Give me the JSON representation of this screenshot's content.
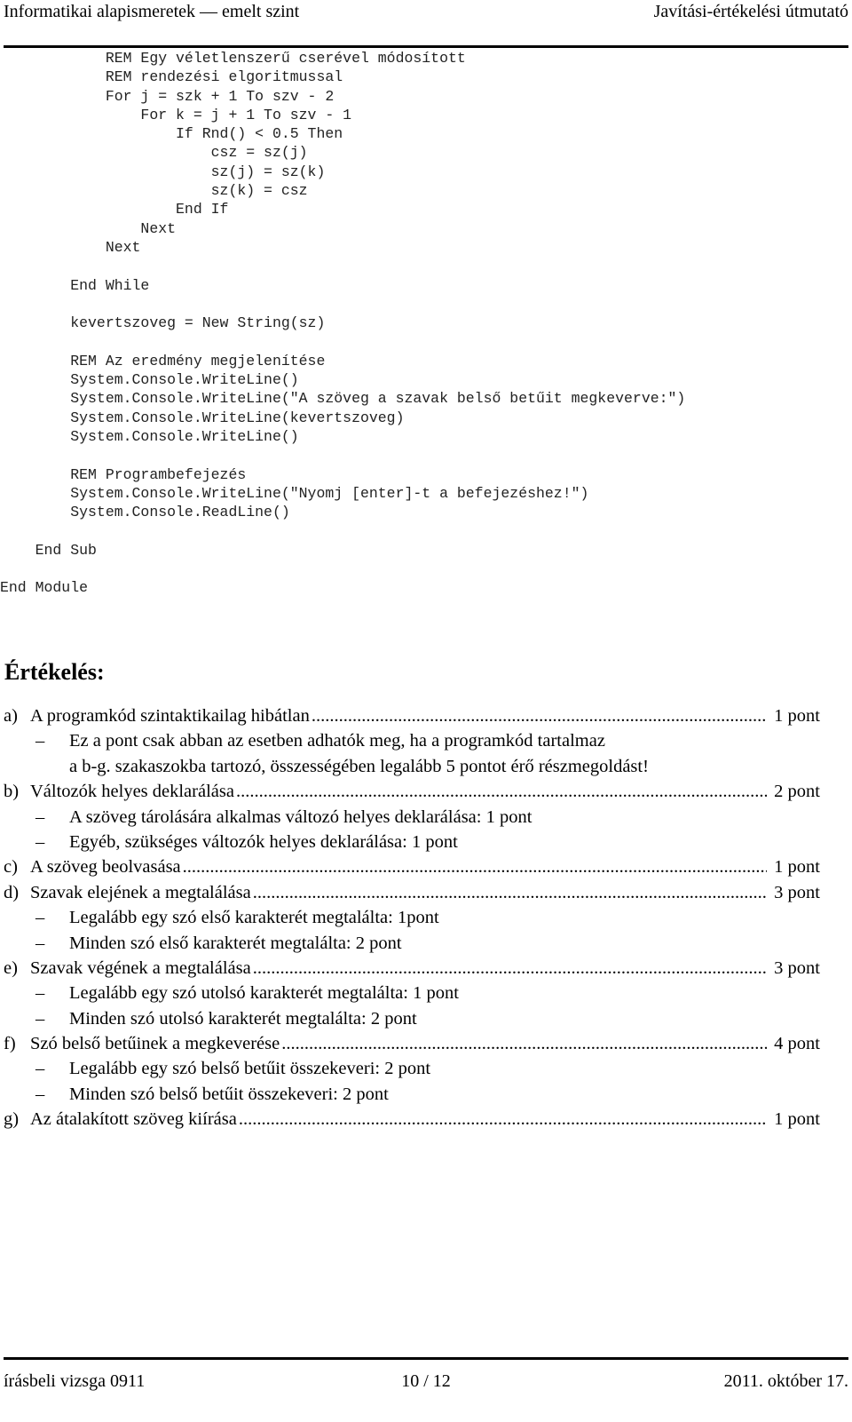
{
  "header": {
    "left": "Informatikai alapismeretek — emelt szint",
    "right": "Javítási-értékelési útmutató"
  },
  "code": {
    "lines": [
      "            REM Egy véletlenszerű cserével módosított",
      "            REM rendezési elgoritmussal",
      "            For j = szk + 1 To szv - 2",
      "                For k = j + 1 To szv - 1",
      "                    If Rnd() < 0.5 Then",
      "                        csz = sz(j)",
      "                        sz(j) = sz(k)",
      "                        sz(k) = csz",
      "                    End If",
      "                Next",
      "            Next",
      "",
      "        End While",
      "",
      "        kevertszoveg = New String(sz)",
      "",
      "        REM Az eredmény megjelenítése",
      "        System.Console.WriteLine()",
      "        System.Console.WriteLine(\"A szöveg a szavak belső betűit megkeverve:\")",
      "        System.Console.WriteLine(kevertszoveg)",
      "        System.Console.WriteLine()",
      "",
      "        REM Programbefejezés",
      "        System.Console.WriteLine(\"Nyomj [enter]-t a befejezéshez!\")",
      "        System.Console.ReadLine()",
      "",
      "    End Sub",
      "",
      "End Module"
    ]
  },
  "evaluation": {
    "title": "Értékelés:",
    "items": [
      {
        "letter": "a)",
        "text": "A programkód szintaktikailag hibátlan",
        "points": "1 pont",
        "subs": [
          "Ez a pont csak abban az esetben adhatók meg, ha a programkód tartalmaz",
          "a b-g. szakaszokba tartozó, összességében legalább 5 pontot érő részmegoldást!"
        ],
        "sub_is_continuation": true
      },
      {
        "letter": "b)",
        "text": "Változók helyes deklarálása",
        "points": "2 pont",
        "subs": [
          "A szöveg tárolására alkalmas változó helyes deklarálása: 1 pont",
          "Egyéb, szükséges változók helyes deklarálása: 1 pont"
        ]
      },
      {
        "letter": "c)",
        "text": "A szöveg beolvasása",
        "points": "1 pont",
        "subs": []
      },
      {
        "letter": "d)",
        "text": "Szavak elejének a megtalálása",
        "points": "3 pont",
        "subs": [
          "Legalább egy szó első karakterét megtalálta: 1pont",
          "Minden szó első karakterét megtalálta: 2 pont"
        ]
      },
      {
        "letter": "e)",
        "text": "Szavak végének a megtalálása",
        "points": "3 pont",
        "subs": [
          "Legalább egy szó utolsó karakterét megtalálta: 1 pont",
          "Minden szó utolsó karakterét megtalálta: 2 pont"
        ]
      },
      {
        "letter": "f)",
        "text": "Szó belső betűinek a megkeverése",
        "points": "4 pont",
        "subs": [
          "Legalább egy szó belső betűit összekeveri: 2 pont",
          "Minden szó belső betűit összekeveri: 2 pont"
        ]
      },
      {
        "letter": "g)",
        "text": "Az átalakított szöveg kiírása",
        "points": "1 pont",
        "subs": []
      }
    ],
    "dash": "–"
  },
  "footer": {
    "left": "írásbeli vizsga 0911",
    "center": "10 / 12",
    "right": "2011. október 17."
  }
}
